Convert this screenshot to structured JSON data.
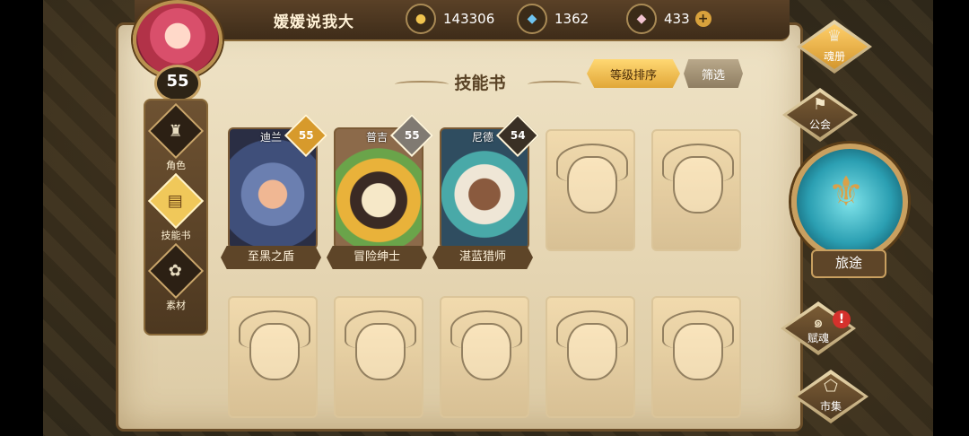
{
  "player": {
    "name": "媛媛说我大",
    "level": "55"
  },
  "currencies": [
    {
      "name": "gold",
      "icon": "gold-coin-icon",
      "value": "143306"
    },
    {
      "name": "crystal",
      "icon": "blue-crystal-icon",
      "value": "1362"
    },
    {
      "name": "gem",
      "icon": "pink-gem-icon",
      "value": "433"
    }
  ],
  "left_nav": [
    {
      "label": "角色",
      "icon": "character-helmet-icon"
    },
    {
      "label": "技能书",
      "icon": "skill-book-icon",
      "active": true
    },
    {
      "label": "素材",
      "icon": "material-icon"
    }
  ],
  "page_title": "技能书",
  "sort": {
    "active": "等级排序",
    "filter": "筛选"
  },
  "skill_books": [
    {
      "hero": "迪兰",
      "book": "至黑之盾",
      "level": "55",
      "level_style": "gold"
    },
    {
      "hero": "普吉",
      "book": "冒险绅士",
      "level": "55",
      "level_style": "gray"
    },
    {
      "hero": "尼德",
      "book": "湛蓝猎师",
      "level": "54",
      "level_style": "dark"
    }
  ],
  "right_nav": [
    {
      "label": "魂册",
      "icon": "soul-book-icon",
      "active": true
    },
    {
      "label": "公会",
      "icon": "guild-banner-icon"
    },
    {
      "label": "赋魂",
      "icon": "soul-swirl-icon"
    },
    {
      "label": "市集",
      "icon": "market-crystal-icon"
    }
  ],
  "journey": {
    "label": "旅途",
    "icon": "journey-emblem-icon"
  },
  "alert": "!"
}
